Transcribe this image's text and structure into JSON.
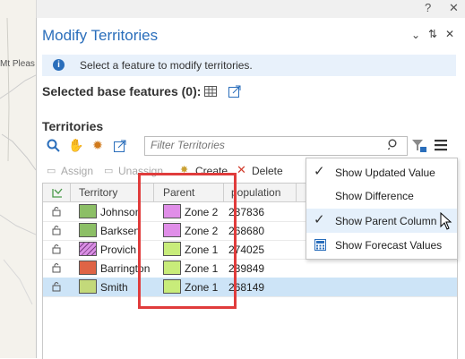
{
  "map": {
    "place_label": "Mt Pleas"
  },
  "title": "Modify Territories",
  "info": {
    "message": "Select a feature to modify territories."
  },
  "selected_base_features": {
    "label": "Selected base features (0):"
  },
  "territories": {
    "heading": "Territories",
    "filter_placeholder": "Filter Territories",
    "actions": {
      "assign": "Assign",
      "unassign": "Unassign",
      "create": "Create",
      "delete": "Delete"
    },
    "columns": [
      "Territory",
      "Parent",
      "population"
    ],
    "rows": [
      {
        "territory": "Johnson",
        "color": "#8cbf66",
        "pattern": "",
        "parent": "Zone 2",
        "parent_color": "#e08ee8",
        "population": "237836",
        "selected": false
      },
      {
        "territory": "Barksen",
        "color": "#8cbf66",
        "pattern": "",
        "parent": "Zone 2",
        "parent_color": "#e08ee8",
        "population": "268680",
        "selected": false
      },
      {
        "territory": "Provich",
        "color": "#d98fe3",
        "pattern": "hatch",
        "parent": "Zone 1",
        "parent_color": "#c8ec7a",
        "population": "274025",
        "selected": false
      },
      {
        "territory": "Barrington",
        "color": "#df6446",
        "pattern": "",
        "parent": "Zone 1",
        "parent_color": "#c8ec7a",
        "population": "239849",
        "selected": false
      },
      {
        "territory": "Smith",
        "color": "#c3d97a",
        "pattern": "",
        "parent": "Zone 1",
        "parent_color": "#c8ec7a",
        "population": "268149",
        "selected": true
      }
    ]
  },
  "menu": {
    "items": [
      {
        "label": "Show Updated Value",
        "checked": true,
        "hover": false
      },
      {
        "label": "Show Difference",
        "checked": false,
        "hover": false
      },
      {
        "label": "Show Parent Column",
        "checked": true,
        "hover": true
      },
      {
        "label": "Show Forecast Values",
        "checked": false,
        "hover": false
      }
    ]
  },
  "colors": {
    "accent": "#2a6ebb",
    "highlight": "#e03c3c",
    "selected_row": "#cde4f7",
    "info_bg": "#e8f1fb"
  },
  "icons": [
    "chevron-down-icon",
    "help-icon",
    "close-icon",
    "pin-icon",
    "info-icon",
    "table-icon",
    "popout-icon",
    "zoom-icon",
    "pan-icon",
    "flash-icon",
    "zoom-to-icon",
    "search-icon",
    "clear-filter-icon",
    "hamburger-menu-icon",
    "lock-icon",
    "calculator-icon",
    "cursor-icon"
  ]
}
